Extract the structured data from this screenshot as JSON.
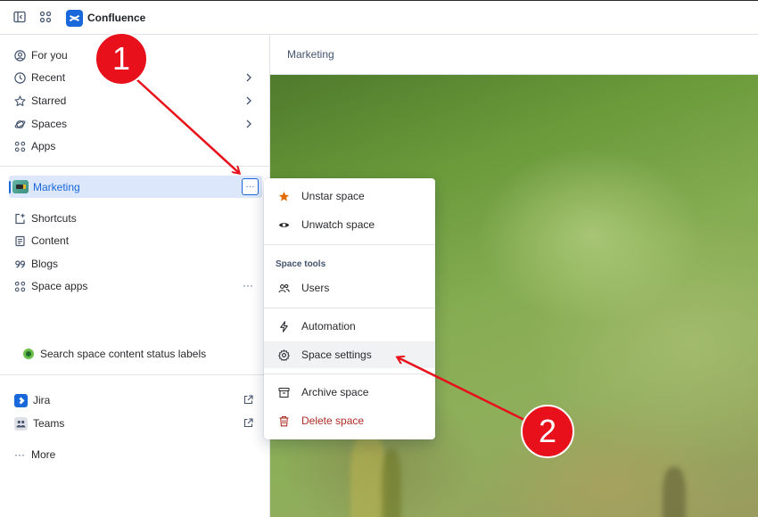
{
  "app": {
    "title": "Confluence"
  },
  "sidebar": {
    "top_items": [
      {
        "label": "For you",
        "icon": "user-circle-icon"
      },
      {
        "label": "Recent",
        "icon": "clock-icon"
      },
      {
        "label": "Starred",
        "icon": "star-icon"
      },
      {
        "label": "Spaces",
        "icon": "planet-icon"
      },
      {
        "label": "Apps",
        "icon": "apps-grid-icon"
      }
    ],
    "space": {
      "label": "Marketing",
      "more_label": "···"
    },
    "space_items": [
      {
        "label": "Shortcuts",
        "icon": "shortcut-icon"
      },
      {
        "label": "Content",
        "icon": "content-icon"
      },
      {
        "label": "Blogs",
        "icon": "quote-icon"
      },
      {
        "label": "Space apps",
        "icon": "apps-grid-icon",
        "more": "···"
      }
    ],
    "status_labels": "Search space content status labels",
    "bottom_items": [
      {
        "label": "Jira",
        "icon": "jira-icon"
      },
      {
        "label": "Teams",
        "icon": "teams-icon"
      },
      {
        "label": "More",
        "icon": "more-dots-icon",
        "glyph": "···"
      }
    ]
  },
  "main": {
    "breadcrumb": "Marketing"
  },
  "menu": {
    "items_top": [
      {
        "label": "Unstar space",
        "icon": "star-filled-icon"
      },
      {
        "label": "Unwatch space",
        "icon": "eye-icon"
      }
    ],
    "section_header": "Space tools",
    "users": {
      "label": "Users",
      "icon": "users-icon"
    },
    "automation": {
      "label": "Automation",
      "icon": "lightning-icon"
    },
    "settings": {
      "label": "Space settings",
      "icon": "gear-icon"
    },
    "archive": {
      "label": "Archive space",
      "icon": "archive-icon"
    },
    "delete": {
      "label": "Delete space",
      "icon": "trash-icon"
    }
  },
  "annotations": {
    "step1": "1",
    "step2": "2"
  },
  "colors": {
    "accent": "#1868db",
    "selected_bg": "#dce7fb",
    "danger": "#ae2e24",
    "star": "#e06c00",
    "annotation": "#e8101a"
  }
}
